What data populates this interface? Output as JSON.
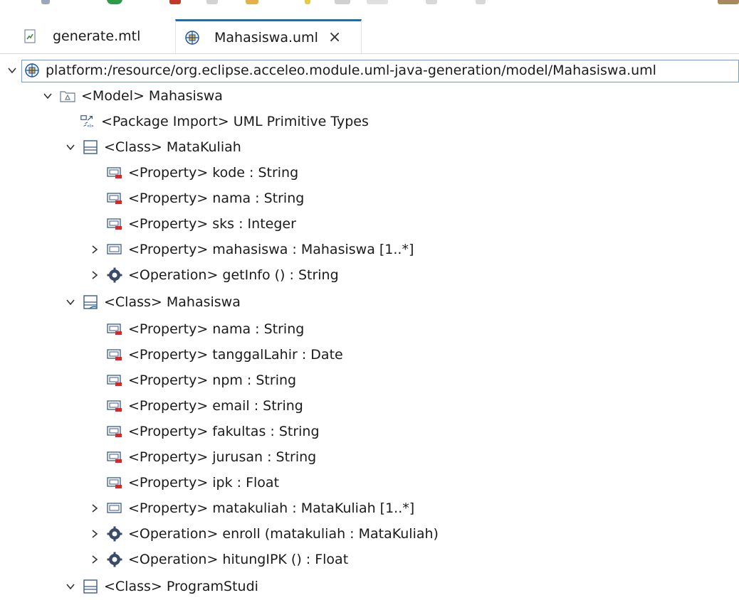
{
  "tabs": [
    {
      "label": "generate.mtl",
      "active": false
    },
    {
      "label": "Mahasiswa.uml",
      "active": true,
      "close": "×"
    }
  ],
  "tree": {
    "root": "platform:/resource/org.eclipse.acceleo.module.uml-java-generation/model/Mahasiswa.uml",
    "model": "<Model> Mahasiswa",
    "package_import": "<Package Import> UML Primitive Types",
    "class_matakuliah": {
      "label": "<Class> MataKuliah",
      "items": [
        "<Property> kode : String",
        "<Property> nama : String",
        "<Property> sks : Integer",
        "<Property> mahasiswa : Mahasiswa [1..*]",
        "<Operation> getInfo () : String"
      ]
    },
    "class_mahasiswa": {
      "label": "<Class> Mahasiswa",
      "items": [
        "<Property> nama : String",
        "<Property> tanggalLahir : Date",
        "<Property> npm : String",
        "<Property> email : String",
        "<Property> fakultas : String",
        "<Property> jurusan : String",
        "<Property> ipk : Float",
        "<Property> matakuliah : MataKuliah [1..*]",
        "<Operation> enroll (matakuliah : MataKuliah)",
        "<Operation> hitungIPK () : Float"
      ]
    },
    "class_programstudi": {
      "label": "<Class> ProgramStudi"
    }
  },
  "colors": {
    "selection_border": "#6aa0d8",
    "tab_accent": "#1a6bb8",
    "property_red": "#d62828",
    "gear": "#3a4a6b"
  }
}
